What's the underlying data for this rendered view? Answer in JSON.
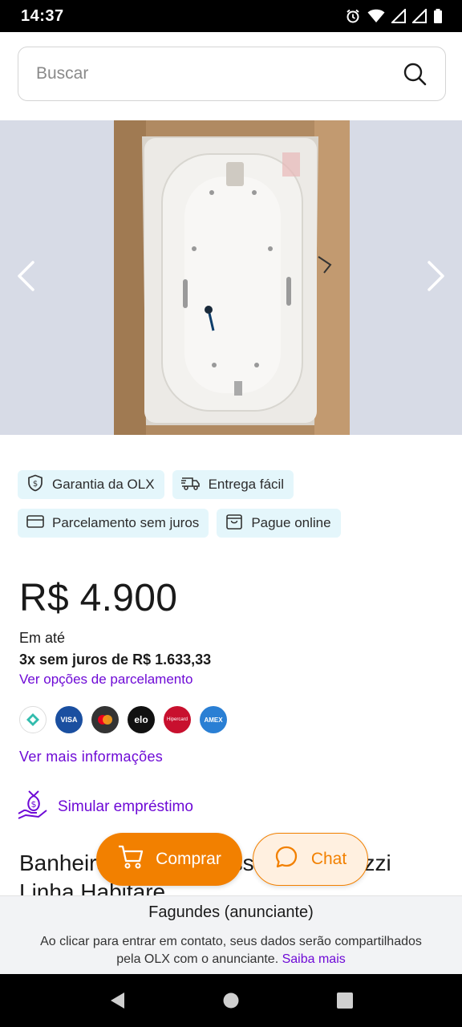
{
  "status_bar": {
    "time": "14:37"
  },
  "search": {
    "placeholder": "Buscar"
  },
  "badges": [
    {
      "label": "Garantia da OLX",
      "icon": "shield-dollar-icon"
    },
    {
      "label": "Entrega fácil",
      "icon": "delivery-truck-icon"
    },
    {
      "label": "Parcelamento sem juros",
      "icon": "credit-card-icon"
    },
    {
      "label": "Pague online",
      "icon": "shopping-bag-icon"
    }
  ],
  "price": {
    "value": "R$ 4.900",
    "em_ate": "Em até",
    "installments": "3x sem juros de R$ 1.633,33",
    "options_link": "Ver opções de parcelamento"
  },
  "payment_methods": [
    {
      "name": "pix",
      "color": "#ffffff"
    },
    {
      "name": "visa",
      "label": "VISA",
      "color": "#1a4fa0"
    },
    {
      "name": "mastercard",
      "color": "#333333"
    },
    {
      "name": "elo",
      "label": "elo",
      "color": "#111111"
    },
    {
      "name": "hipercard",
      "label": "Hipercard",
      "color": "#c8102e"
    },
    {
      "name": "amex",
      "label": "AMEX",
      "color": "#2a7fd4"
    }
  ],
  "more_info_link": "Ver mais informações",
  "loan_link": "Simular empréstimo",
  "ad": {
    "title": "Banheira de Hidromassagem Jacuzzi Linha Habitare"
  },
  "actions": {
    "buy_label": "Comprar",
    "chat_label": "Chat"
  },
  "advertiser": {
    "name_line": "Fagundes (anunciante)"
  },
  "disclaimer": {
    "text_line1": "Ao clicar para entrar em contato, seus dados serão compartilhados",
    "text_line2": "pela OLX com o anunciante.",
    "link": "Saiba mais"
  },
  "colors": {
    "accent_purple": "#6e0ad6",
    "accent_orange": "#f28000",
    "badge_bg": "#e4f6fb"
  }
}
